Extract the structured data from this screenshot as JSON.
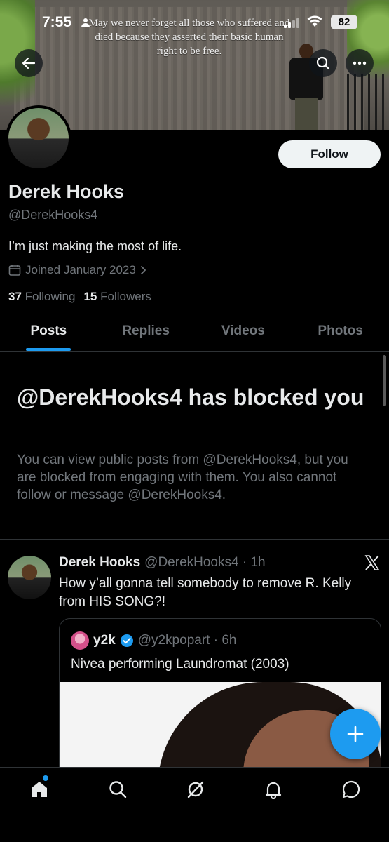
{
  "status_bar": {
    "time": "7:55",
    "battery": "82"
  },
  "banner": {
    "quote": "May we never forget all those who suffered and died because they asserted their basic human right to be free."
  },
  "profile": {
    "display_name": "Derek Hooks",
    "handle": "@DerekHooks4",
    "bio": "I’m just making the most of life.",
    "joined": "Joined January 2023",
    "following_count": "37",
    "following_label": "Following",
    "followers_count": "15",
    "followers_label": "Followers",
    "follow_button": "Follow"
  },
  "tabs": [
    {
      "label": "Posts",
      "active": true
    },
    {
      "label": "Replies",
      "active": false
    },
    {
      "label": "Videos",
      "active": false
    },
    {
      "label": "Photos",
      "active": false
    }
  ],
  "blocked": {
    "title": "@DerekHooks4 has blocked you",
    "body": "You can view public posts from @DerekHooks4, but you are blocked from engaging with them. You also cannot follow or message @DerekHooks4."
  },
  "tweet": {
    "name": "Derek Hooks",
    "handle_time": "@DerekHooks4 · 1h",
    "text": "How y’all gonna tell somebody to remove R. Kelly from HIS SONG?!",
    "quote": {
      "name": "y2k",
      "handle_time": "@y2kpopart · 6h",
      "text": "Nivea performing Laundromat (2003)"
    }
  },
  "colors": {
    "accent": "#1d9bf0",
    "background": "#000000",
    "muted": "#71767b"
  },
  "icons": {
    "back": "arrow-left-icon",
    "search": "search-icon",
    "more": "more-icon",
    "calendar": "calendar-icon",
    "verified": "verified-badge-icon",
    "x_logo": "x-logo-icon",
    "compose": "plus-icon",
    "nav": [
      "home-icon",
      "search-icon",
      "grok-icon",
      "bell-icon",
      "message-icon"
    ]
  }
}
